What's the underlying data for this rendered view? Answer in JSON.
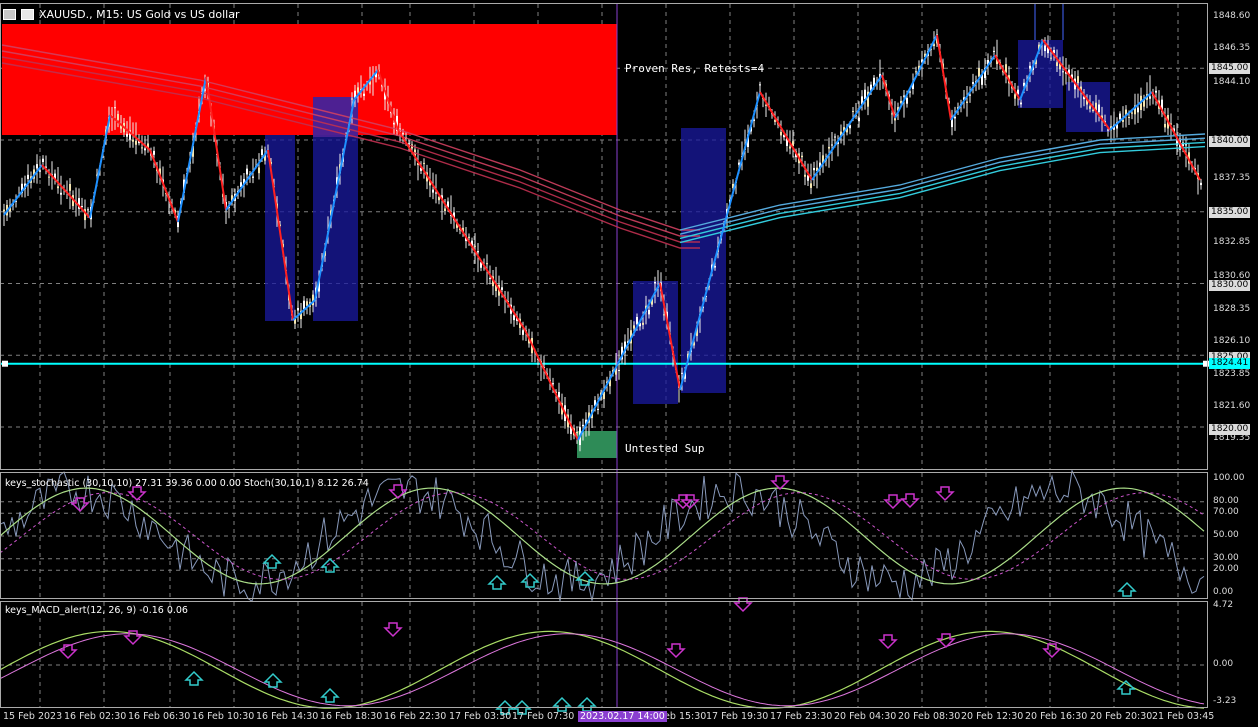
{
  "window": {
    "symbol_title": "XAUUSD., M15:  US Gold vs US dollar"
  },
  "zones": {
    "resistance_label": "Proven Res, Retests=4",
    "support_label": "Untested Sup"
  },
  "price_axis": {
    "ticks": [
      "1848.60",
      "1846.35",
      "1844.10",
      "1839.60",
      "1837.35",
      "1832.85",
      "1830.60",
      "1828.35",
      "1826.10",
      "1823.85",
      "1821.60",
      "1819.35"
    ],
    "tagged_levels": [
      "1845.00",
      "1840.00",
      "1835.00",
      "1830.00",
      "1825.00",
      "1820.00"
    ],
    "current_line_label": "1824.41"
  },
  "stochastic": {
    "label": "keys_stochastic (30,10,10) 27.31 39.36 0.00 0.00 Stoch(30,10,1) 8.12 26.74",
    "ticks": [
      "100.00",
      "80.00",
      "70.00",
      "50.00",
      "30.00",
      "20.00",
      "0.00"
    ]
  },
  "macd": {
    "label": "keys_MACD_alert(12, 26, 9) -0.16 0.06",
    "ticks": [
      "4.72",
      "0.00",
      "-3.23"
    ]
  },
  "time_axis": {
    "ticks": [
      "15 Feb 2023",
      "16 Feb 02:30",
      "16 Feb 06:30",
      "16 Feb 10:30",
      "16 Feb 14:30",
      "16 Feb 18:30",
      "16 Feb 22:30",
      "17 Feb 03:30",
      "17 Feb 07:30",
      "17 Feb 15:30",
      "17 Feb 19:30",
      "17 Feb 23:30",
      "20 Feb 04:30",
      "20 Feb 08:30",
      "20 Feb 12:30",
      "20 Feb 16:30",
      "20 Feb 20:30",
      "21 Feb 03:45"
    ],
    "cursor_label": "2023.02.17 14:00"
  },
  "colors": {
    "resistance_zone": "#ff0000",
    "support_zone": "#2e8b57",
    "current_price_line": "#00ffff",
    "bull_zigzag": "#1e90ff",
    "bear_zigzag": "#ff2020",
    "arrow_down": "#cc33cc",
    "arrow_up": "#33cccc",
    "grid": "#7f7f7f",
    "cursor_line": "#8a3fd0"
  }
}
